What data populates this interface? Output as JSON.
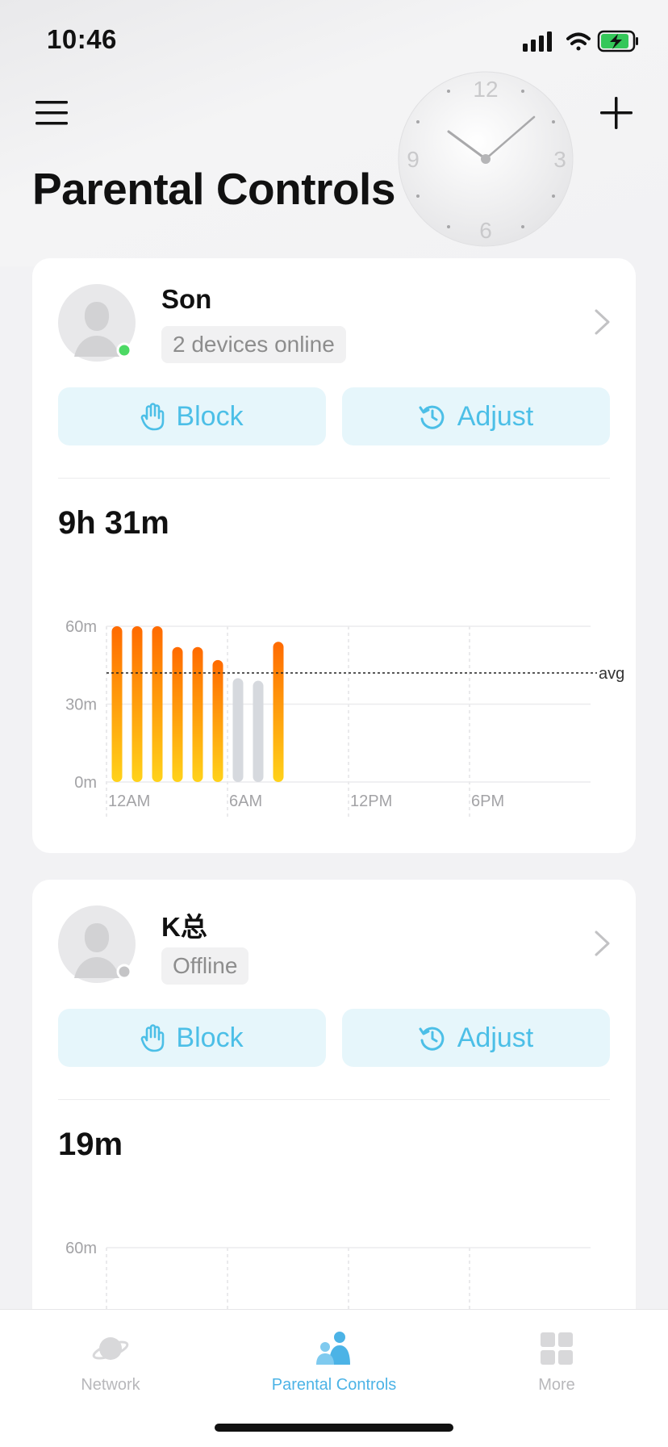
{
  "status_bar": {
    "time": "10:46"
  },
  "header": {
    "title": "Parental Controls"
  },
  "clock": {
    "numbers": [
      "12",
      "3",
      "6",
      "9"
    ]
  },
  "profiles": [
    {
      "name": "Son",
      "status": "2 devices online",
      "online": true,
      "block_label": "Block",
      "adjust_label": "Adjust",
      "usage_total": "9h 31m"
    },
    {
      "name": "K总",
      "status": "Offline",
      "online": false,
      "block_label": "Block",
      "adjust_label": "Adjust",
      "usage_total": "19m"
    }
  ],
  "chart_data": [
    {
      "type": "bar",
      "y_ticks": [
        "60m",
        "30m",
        "0m"
      ],
      "x_ticks": [
        "12AM",
        "6AM",
        "12PM",
        "6PM"
      ],
      "ylim": [
        0,
        60
      ],
      "avg_label": "avg",
      "avg_value": 42,
      "x_hours": [
        1,
        2,
        3,
        4,
        5,
        6,
        7,
        8,
        9
      ],
      "values": [
        60,
        60,
        60,
        52,
        52,
        47,
        40,
        39,
        54
      ],
      "active": [
        true,
        true,
        true,
        true,
        true,
        true,
        false,
        false,
        true
      ],
      "colors": {
        "bar_top": "#ff6a00",
        "bar_bottom": "#ffd21a",
        "inactive": "#d6d9de"
      }
    },
    {
      "type": "bar",
      "y_ticks": [
        "60m"
      ],
      "x_ticks": [],
      "ylim": [
        0,
        60
      ],
      "values": []
    }
  ],
  "tabbar": {
    "items": [
      {
        "label": "Network",
        "icon": "planet-icon"
      },
      {
        "label": "Parental Controls",
        "icon": "family-icon"
      },
      {
        "label": "More",
        "icon": "grid-icon"
      }
    ],
    "active_index": 1
  },
  "colors": {
    "accent": "#4cbfe7",
    "online": "#4cd964",
    "offline": "#c4c4c6"
  }
}
